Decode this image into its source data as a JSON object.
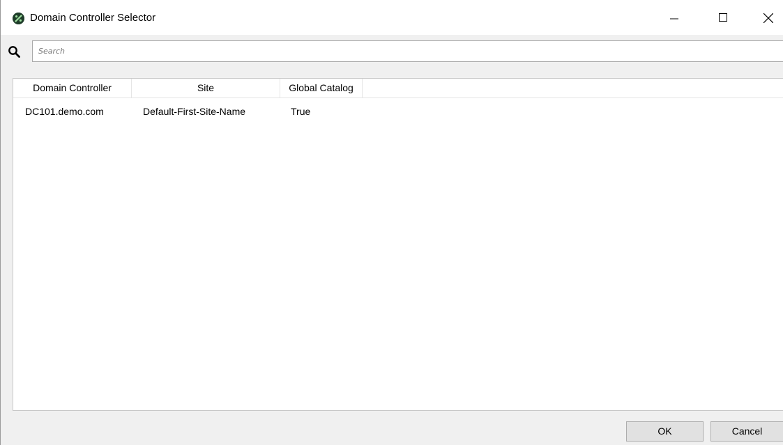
{
  "window": {
    "title": "Domain Controller Selector",
    "controls": {
      "minimize_icon": "minimize-icon",
      "maximize_icon": "maximize-icon",
      "close_icon": "close-icon"
    },
    "app_icon": "app-logo-icon",
    "app_icon_color": "#1f3d2a"
  },
  "search": {
    "icon": "search-icon",
    "placeholder": "Search",
    "value": ""
  },
  "table": {
    "columns": [
      "Domain Controller",
      "Site",
      "Global Catalog"
    ],
    "rows": [
      [
        "DC101.demo.com",
        "Default-First-Site-Name",
        "True"
      ]
    ]
  },
  "footer": {
    "ok_label": "OK",
    "cancel_label": "Cancel"
  }
}
